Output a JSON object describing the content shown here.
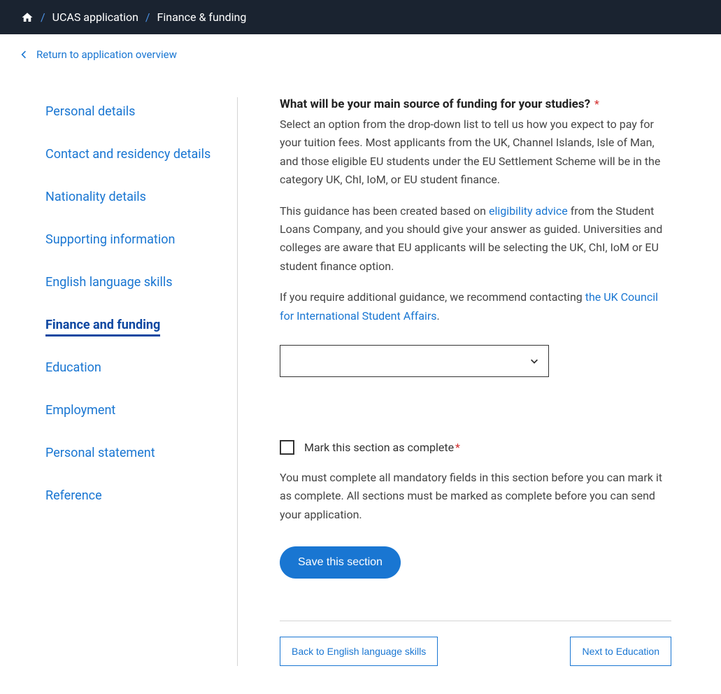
{
  "breadcrumb": {
    "item1": "UCAS application",
    "item2": "Finance & funding"
  },
  "back_link": "Return to application overview",
  "sidebar": {
    "items": [
      {
        "label": "Personal details",
        "active": false
      },
      {
        "label": "Contact and residency details",
        "active": false
      },
      {
        "label": "Nationality details",
        "active": false
      },
      {
        "label": "Supporting information",
        "active": false
      },
      {
        "label": "English language skills",
        "active": false
      },
      {
        "label": "Finance and funding",
        "active": true
      },
      {
        "label": "Education",
        "active": false
      },
      {
        "label": "Employment",
        "active": false
      },
      {
        "label": "Personal statement",
        "active": false
      },
      {
        "label": "Reference",
        "active": false
      }
    ]
  },
  "question": {
    "label": "What will be your main source of funding for your studies?",
    "help1": "Select an option from the drop-down list to tell us how you expect to pay for your tuition fees. Most applicants from the UK, Channel Islands, Isle of Man, and those eligible EU students under the EU Settlement Scheme will be in the category UK, ChI, IoM, or EU student finance.",
    "help2_before": "This guidance has been created based on ",
    "help2_link": "eligibility advice",
    "help2_after": " from the Student Loans Company, and you should give your answer as guided. Universities and colleges are aware that EU applicants will be selecting the UK, ChI, IoM or EU student finance option.",
    "help3_before": "If you require additional guidance, we recommend contacting ",
    "help3_link": "the UK Council for International Student Affairs",
    "help3_after": ".",
    "select_value": ""
  },
  "complete": {
    "checkbox_label": "Mark this section as complete",
    "help": "You must complete all mandatory fields in this section before you can mark it as complete. All sections must be marked as complete before you can send your application.",
    "save_button": "Save this section"
  },
  "nav": {
    "back": "Back to English language skills",
    "next": "Next to Education"
  },
  "required_marker": "*"
}
